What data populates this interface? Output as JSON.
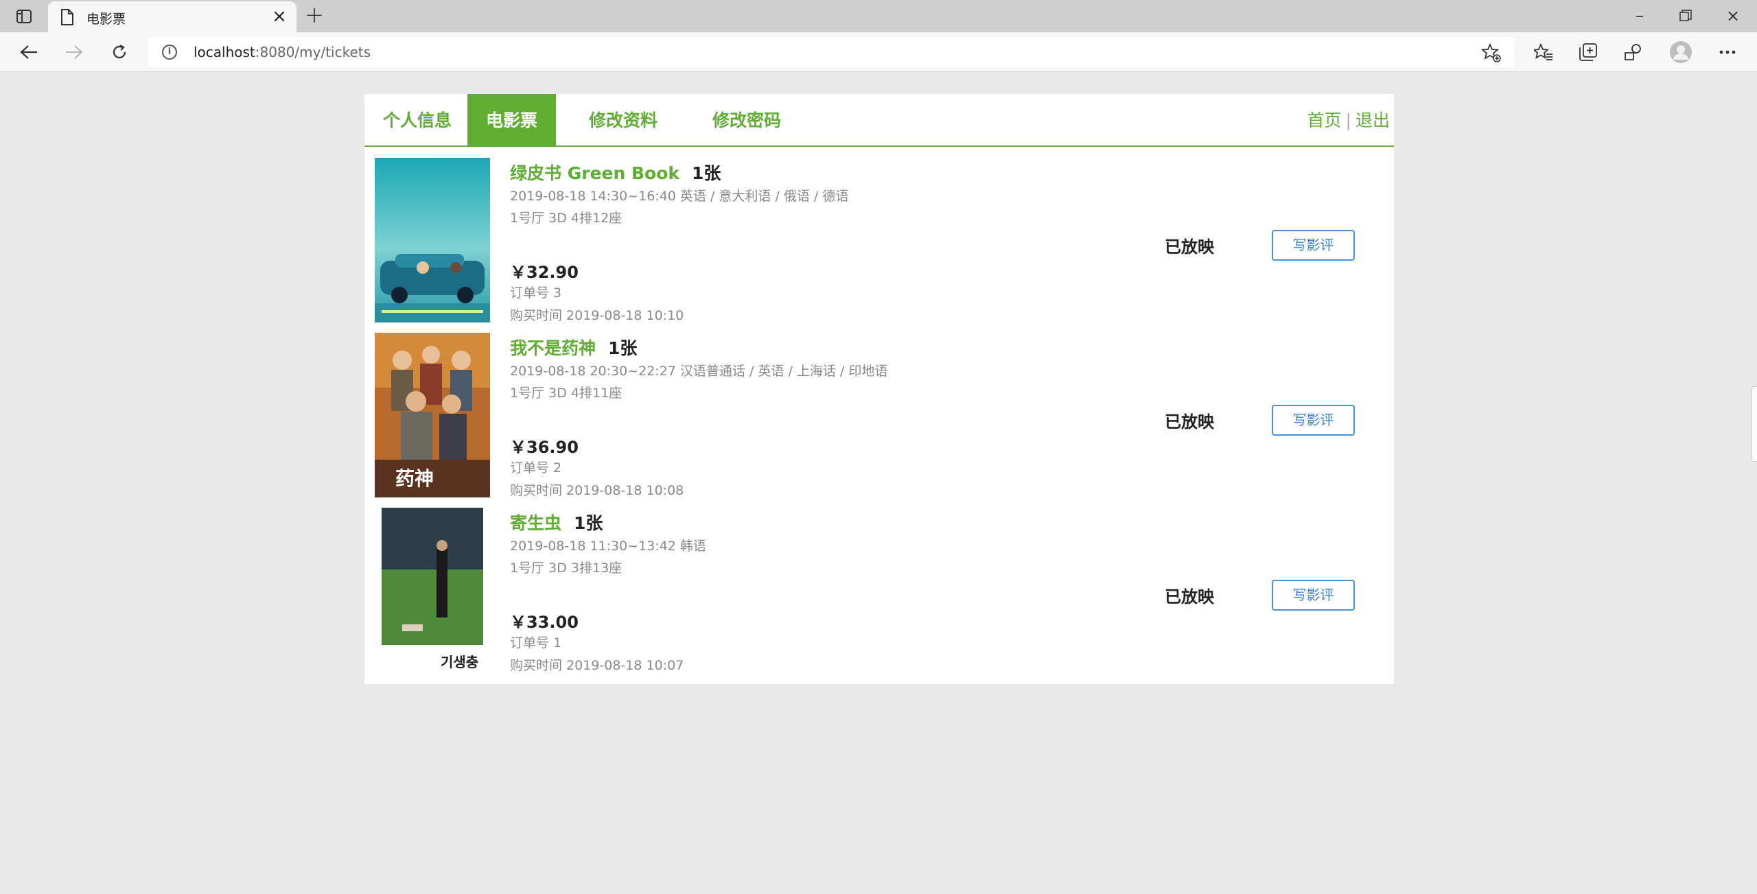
{
  "browser": {
    "tab_title": "电影票",
    "address": {
      "host": "localhost",
      "rest": ":8080/my/tickets"
    }
  },
  "nav": {
    "items": [
      "个人信息",
      "电影票",
      "修改资料",
      "修改密码"
    ],
    "active_index": 1,
    "home": "首页",
    "separator": "|",
    "logout": "退出"
  },
  "tickets": [
    {
      "title": "绿皮书 Green Book",
      "count": "1张",
      "time_lang": "2019-08-18 14:30~16:40   英语 / 意大利语 / 俄语 / 德语",
      "hall": "1号厅   3D    4排12座",
      "price": "￥32.90",
      "order": "订单号   3",
      "purchase": "购买时间   2019-08-18 10:10",
      "status": "已放映",
      "review_label": "写影评"
    },
    {
      "title": "我不是药神",
      "count": "1张",
      "time_lang": "2019-08-18 20:30~22:27   汉语普通话 / 英语 / 上海话 / 印地语",
      "hall": "1号厅   3D    4排11座",
      "price": "￥36.90",
      "order": "订单号   2",
      "purchase": "购买时间   2019-08-18 10:08",
      "status": "已放映",
      "review_label": "写影评"
    },
    {
      "title": "寄生虫",
      "count": "1张",
      "time_lang": "2019-08-18 11:30~13:42   韩语",
      "hall": "1号厅   3D    3排13座",
      "price": "￥33.00",
      "order": "订单号   1",
      "purchase": "购买时间   2019-08-18 10:07",
      "status": "已放映",
      "review_label": "写影评"
    }
  ],
  "colors": {
    "accent": "#5fae33",
    "button": "#3b82d4",
    "page_bg": "#e9e9e9"
  },
  "icons": [
    "tab-actions-icon",
    "document-icon",
    "close-icon",
    "plus-icon",
    "back-icon",
    "forward-icon",
    "refresh-icon",
    "info-icon",
    "favorite-add-icon",
    "favorites-icon",
    "collections-icon",
    "extensions-icon",
    "profile-icon",
    "more-icon"
  ]
}
